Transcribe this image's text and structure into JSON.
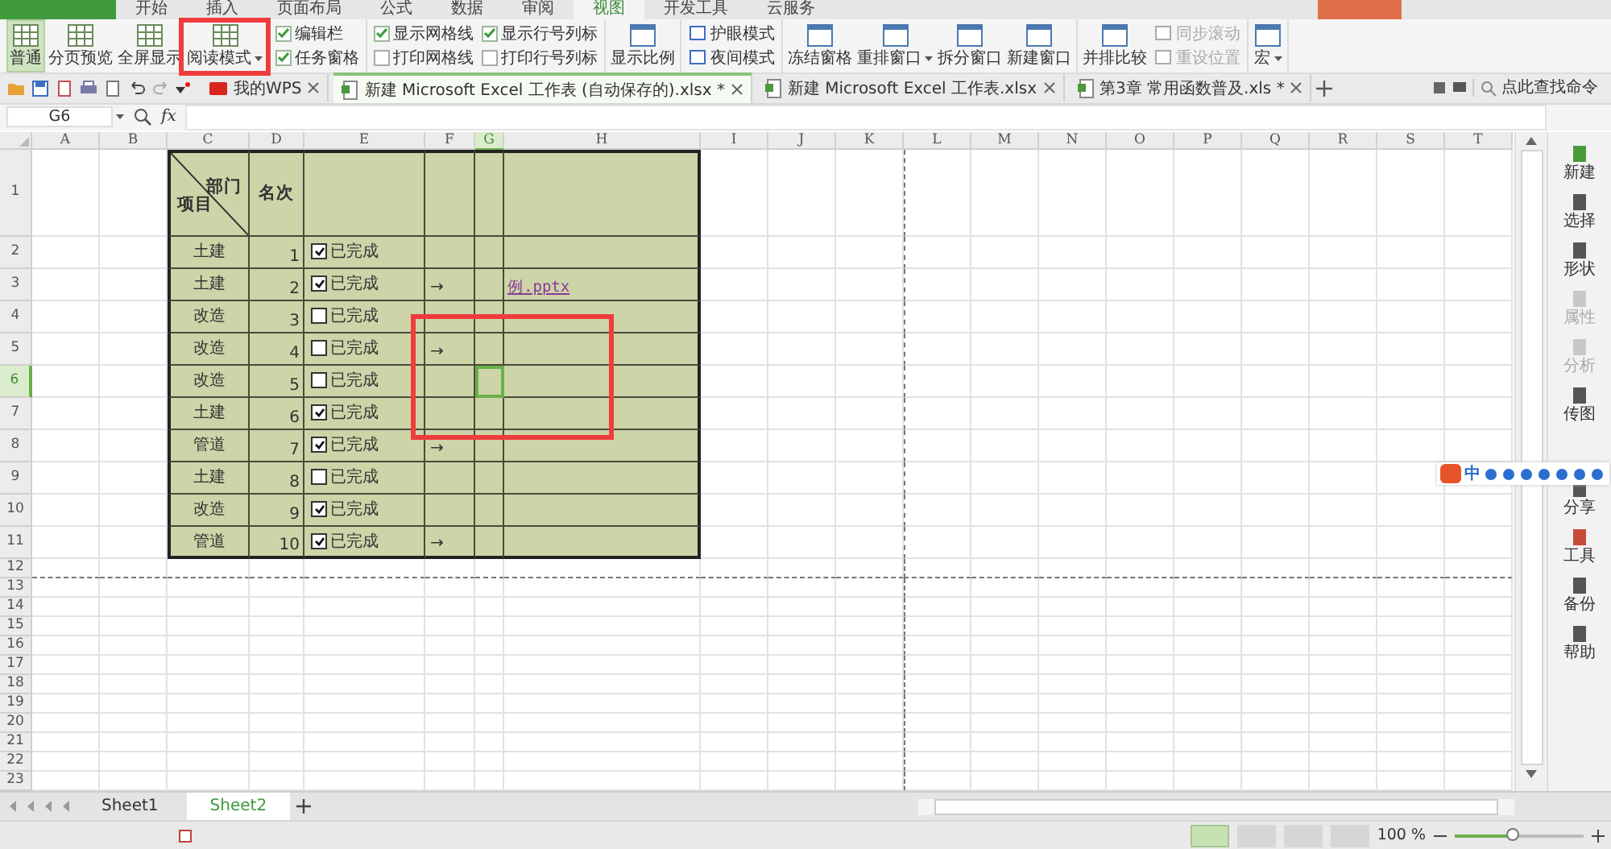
{
  "menu_tabs": [
    {
      "label": "开始",
      "selected": false
    },
    {
      "label": "插入",
      "selected": false
    },
    {
      "label": "页面布局",
      "selected": false
    },
    {
      "label": "公式",
      "selected": false
    },
    {
      "label": "数据",
      "selected": false
    },
    {
      "label": "审阅",
      "selected": false
    },
    {
      "label": "视图",
      "selected": true
    },
    {
      "label": "开发工具",
      "selected": false
    },
    {
      "label": "云服务",
      "selected": false
    }
  ],
  "ribbon": {
    "groups": [
      {
        "items": [
          {
            "kind": "large",
            "label": "普通",
            "selected": true
          },
          {
            "kind": "large",
            "label": "分页预览",
            "selected": false
          },
          {
            "kind": "large",
            "label": "全屏显示",
            "selected": false
          },
          {
            "kind": "large",
            "label": "阅读模式",
            "selected": false,
            "dropdown": true
          }
        ]
      },
      {
        "items": [
          {
            "kind": "stack",
            "items": [
              {
                "kind": "check",
                "label": "编辑栏",
                "checked": true
              },
              {
                "kind": "check",
                "label": "任务窗格",
                "checked": true
              }
            ]
          }
        ]
      },
      {
        "items": [
          {
            "kind": "stack",
            "items": [
              {
                "kind": "check",
                "label": "显示网格线",
                "checked": true
              },
              {
                "kind": "check",
                "label": "打印网格线",
                "checked": false
              }
            ]
          },
          {
            "kind": "stack",
            "items": [
              {
                "kind": "check",
                "label": "显示行号列标",
                "checked": true
              },
              {
                "kind": "check",
                "label": "打印行号列标",
                "checked": false
              }
            ]
          }
        ]
      },
      {
        "items": [
          {
            "kind": "large",
            "label": "显示比例"
          }
        ]
      },
      {
        "items": [
          {
            "kind": "stack",
            "items": [
              {
                "kind": "small",
                "label": "护眼模式",
                "disabled": false
              },
              {
                "kind": "small",
                "label": "夜间模式",
                "disabled": false
              }
            ]
          }
        ]
      },
      {
        "items": [
          {
            "kind": "large",
            "label": "冻结窗格"
          },
          {
            "kind": "large",
            "label": "重排窗口",
            "dropdown": true
          },
          {
            "kind": "large",
            "label": "拆分窗口"
          },
          {
            "kind": "large",
            "label": "新建窗口"
          }
        ]
      },
      {
        "items": [
          {
            "kind": "large",
            "label": "并排比较"
          },
          {
            "kind": "stack",
            "items": [
              {
                "kind": "small",
                "label": "同步滚动",
                "disabled": true
              },
              {
                "kind": "small",
                "label": "重设位置",
                "disabled": true
              }
            ]
          }
        ]
      },
      {
        "items": [
          {
            "kind": "large",
            "label": "宏",
            "dropdown": true
          }
        ]
      }
    ]
  },
  "doc_tabs": [
    {
      "kind": "home",
      "label": "我的WPS",
      "selected": false
    },
    {
      "kind": "doc",
      "label": "新建 Microsoft Excel 工作表 (自动保存的).xlsx *",
      "selected": true
    },
    {
      "kind": "doc",
      "label": "新建 Microsoft Excel 工作表.xlsx",
      "selected": false
    },
    {
      "kind": "doc",
      "label": "第3章 常用函数普及.xls *",
      "selected": false
    }
  ],
  "command_search": {
    "placeholder": "点此查找命令"
  },
  "formula_bar": {
    "cell_name": "G6",
    "fx_label": "fx"
  },
  "columns": [
    {
      "label": "A",
      "selected": false
    },
    {
      "label": "B",
      "selected": false
    },
    {
      "label": "C",
      "selected": false
    },
    {
      "label": "D",
      "selected": false
    },
    {
      "label": "E",
      "selected": false
    },
    {
      "label": "F",
      "selected": false
    },
    {
      "label": "G",
      "selected": true
    },
    {
      "label": "H",
      "selected": false
    },
    {
      "label": "I",
      "selected": false
    },
    {
      "label": "J",
      "selected": false
    },
    {
      "label": "K",
      "selected": false
    },
    {
      "label": "L",
      "selected": false
    },
    {
      "label": "M",
      "selected": false
    },
    {
      "label": "N",
      "selected": false
    },
    {
      "label": "O",
      "selected": false
    },
    {
      "label": "P",
      "selected": false
    },
    {
      "label": "Q",
      "selected": false
    },
    {
      "label": "R",
      "selected": false
    },
    {
      "label": "S",
      "selected": false
    },
    {
      "label": "T",
      "selected": false
    }
  ],
  "rows": [
    {
      "label": "1",
      "selected": false
    },
    {
      "label": "2",
      "selected": false
    },
    {
      "label": "3",
      "selected": false
    },
    {
      "label": "4",
      "selected": false
    },
    {
      "label": "5",
      "selected": false
    },
    {
      "label": "6",
      "selected": true
    },
    {
      "label": "7",
      "selected": false
    },
    {
      "label": "8",
      "selected": false
    },
    {
      "label": "9",
      "selected": false
    },
    {
      "label": "10",
      "selected": false
    },
    {
      "label": "11",
      "selected": false
    },
    {
      "label": "12",
      "selected": false
    },
    {
      "label": "13",
      "selected": false
    },
    {
      "label": "14",
      "selected": false
    },
    {
      "label": "15",
      "selected": false
    },
    {
      "label": "16",
      "selected": false
    },
    {
      "label": "17",
      "selected": false
    },
    {
      "label": "18",
      "selected": false
    },
    {
      "label": "19",
      "selected": false
    },
    {
      "label": "20",
      "selected": false
    },
    {
      "label": "21",
      "selected": false
    },
    {
      "label": "22",
      "selected": false
    },
    {
      "label": "23",
      "selected": false
    }
  ],
  "table": {
    "corner_top": "部门",
    "corner_bottom": "项目",
    "rank_heading": "名次",
    "rows": [
      {
        "dept": "土建",
        "rank": "1",
        "done": {
          "checked": true,
          "label": "已完成"
        }
      },
      {
        "dept": "土建",
        "rank": "2",
        "done": {
          "checked": true,
          "label": "已完成"
        },
        "arrow": "→",
        "link": "例.pptx"
      },
      {
        "dept": "改造",
        "rank": "3",
        "done": {
          "checked": false,
          "label": "已完成"
        }
      },
      {
        "dept": "改造",
        "rank": "4",
        "done": {
          "checked": false,
          "label": "已完成"
        },
        "arrow": "→"
      },
      {
        "dept": "改造",
        "rank": "5",
        "done": {
          "checked": false,
          "label": "已完成"
        }
      },
      {
        "dept": "土建",
        "rank": "6",
        "done": {
          "checked": true,
          "label": "已完成"
        }
      },
      {
        "dept": "管道",
        "rank": "7",
        "done": {
          "checked": true,
          "label": "已完成"
        },
        "arrow": "→"
      },
      {
        "dept": "土建",
        "rank": "8",
        "done": {
          "checked": false,
          "label": "已完成"
        }
      },
      {
        "dept": "改造",
        "rank": "9",
        "done": {
          "checked": true,
          "label": "已完成"
        }
      },
      {
        "dept": "管道",
        "rank": "10",
        "done": {
          "checked": true,
          "label": "已完成"
        },
        "arrow": "→"
      }
    ]
  },
  "sidebar": {
    "items": [
      {
        "label": "新建",
        "disabled": false
      },
      {
        "label": "选择",
        "disabled": false
      },
      {
        "label": "形状",
        "disabled": false
      },
      {
        "label": "属性",
        "disabled": true
      },
      {
        "label": "分析",
        "disabled": true
      },
      {
        "label": "传图",
        "disabled": false
      },
      {
        "label": "分享",
        "disabled": false
      },
      {
        "label": "工具",
        "disabled": false
      },
      {
        "label": "备份",
        "disabled": false
      },
      {
        "label": "帮助",
        "disabled": false
      }
    ]
  },
  "ime_toolbar": {
    "mode": "中"
  },
  "sheet_tabs": [
    {
      "label": "Sheet1",
      "selected": false
    },
    {
      "label": "Sheet2",
      "selected": true
    }
  ],
  "status_bar": {
    "zoom": "100 %",
    "zoom_slider": {
      "level": 0.45
    }
  }
}
